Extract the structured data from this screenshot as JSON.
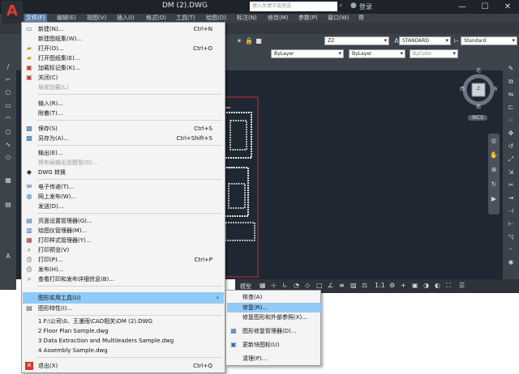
{
  "app": {
    "title": "DM (2).DWG",
    "search_placeholder": "键入关键字或短语",
    "login": "登录"
  },
  "menubar": [
    "文件(F)",
    "编辑(E)",
    "视图(V)",
    "插入(I)",
    "格式(O)",
    "工具(T)",
    "绘图(D)",
    "标注(N)",
    "修改(M)",
    "参数(P)",
    "窗口(W)",
    "帮"
  ],
  "toolbar": {
    "layer_combo": "ZZ",
    "textstyle_combo": "STANDARD",
    "dimstyle_combo": "Standard",
    "linetype_combo": "ByLayer",
    "lineweight_combo": "ByLayer",
    "color_combo": "ByColor"
  },
  "viewcube": {
    "north": "北",
    "south": "南",
    "west": "西",
    "east": "东",
    "top": "上",
    "wcs": "WCS"
  },
  "status": {
    "model_tab": "模型",
    "scale": "1:1"
  },
  "file_menu": [
    {
      "label": "新建(N)...",
      "shortcut": "Ctrl+N",
      "icon": "new-icon"
    },
    {
      "label": "新建图纸集(W)...",
      "shortcut": "",
      "icon": ""
    },
    {
      "label": "打开(O)...",
      "shortcut": "Ctrl+O",
      "icon": "open-icon"
    },
    {
      "label": "打开图纸集(E)...",
      "shortcut": "",
      "icon": "open-sheetset-icon"
    },
    {
      "label": "加载标记集(K)...",
      "shortcut": "",
      "icon": "markup-icon"
    },
    {
      "label": "关闭(C)",
      "shortcut": "",
      "icon": "close-icon"
    },
    {
      "label": "局部加载(L)",
      "shortcut": "",
      "icon": "",
      "disabled": true
    },
    {
      "label": "输入(R)...",
      "shortcut": "",
      "icon": ""
    },
    {
      "label": "附着(T)...",
      "shortcut": "",
      "icon": ""
    },
    {
      "label": "保存(S)",
      "shortcut": "Ctrl+S",
      "icon": "save-icon"
    },
    {
      "label": "另存为(A)...",
      "shortcut": "Ctrl+Shift+S",
      "icon": "saveas-icon"
    },
    {
      "label": "输出(E)...",
      "shortcut": "",
      "icon": ""
    },
    {
      "label": "将布局输出到模型(D)...",
      "shortcut": "",
      "icon": "",
      "disabled": true
    },
    {
      "label": "DWG 转换",
      "shortcut": "",
      "icon": "dwg-convert-icon"
    },
    {
      "label": "电子传递(T)...",
      "shortcut": "",
      "icon": "etransmit-icon"
    },
    {
      "label": "网上发布(W)...",
      "shortcut": "",
      "icon": "publish-web-icon"
    },
    {
      "label": "发送(D)...",
      "shortcut": "",
      "icon": ""
    },
    {
      "label": "页面设置管理器(G)...",
      "shortcut": "",
      "icon": "page-setup-icon"
    },
    {
      "label": "绘图仪管理器(M)...",
      "shortcut": "",
      "icon": "plotter-icon"
    },
    {
      "label": "打印样式管理器(Y)...",
      "shortcut": "",
      "icon": "plot-style-icon"
    },
    {
      "label": "打印预览(V)",
      "shortcut": "",
      "icon": "preview-icon"
    },
    {
      "label": "打印(P)...",
      "shortcut": "Ctrl+P",
      "icon": "print-icon"
    },
    {
      "label": "发布(H)...",
      "shortcut": "",
      "icon": "publish-icon"
    },
    {
      "label": "查看打印和发布详细信息(B)...",
      "shortcut": "",
      "icon": "plot-details-icon"
    },
    {
      "label": "图形实用工具(U)",
      "shortcut": "",
      "icon": "",
      "submenu": true
    },
    {
      "label": "图形特性(I)...",
      "shortcut": "",
      "icon": "properties-icon"
    },
    {
      "label": "1 F:\\公司\\0、王漫雨\\CAD相关\\DM (2).DWG",
      "shortcut": "",
      "icon": ""
    },
    {
      "label": "2 Floor Plan Sample.dwg",
      "shortcut": "",
      "icon": ""
    },
    {
      "label": "3 Data Extraction and Multileaders Sample.dwg",
      "shortcut": "",
      "icon": ""
    },
    {
      "label": "4 Assembly Sample.dwg",
      "shortcut": "",
      "icon": ""
    },
    {
      "label": "退出(X)",
      "shortcut": "Ctrl+Q",
      "icon": "exit-icon"
    }
  ],
  "submenu": [
    {
      "label": "核查(A)",
      "icon": ""
    },
    {
      "label": "修复(R)...",
      "icon": ""
    },
    {
      "label": "修复图形和外部参照(X)...",
      "icon": ""
    },
    {
      "label": "图形修复管理器(D)...",
      "icon": "drawing-recovery-icon"
    },
    {
      "label": "更新块图标(U)",
      "icon": "update-block-icon"
    },
    {
      "label": "清理(P)...",
      "icon": ""
    }
  ]
}
